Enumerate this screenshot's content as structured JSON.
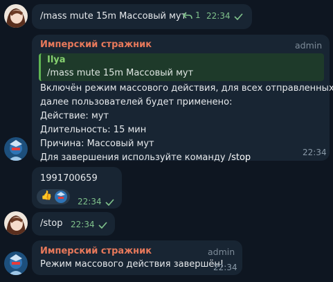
{
  "messages": {
    "m1": {
      "text": "/mass mute 15m Массовый мут",
      "replies": "1",
      "time": "22:34"
    },
    "m2": {
      "sender": "Имперский стражник",
      "role": "admin",
      "quote_author": "Ilya",
      "quote_text": "/mass mute 15m Массовый мут",
      "lines": [
        "Включён режим массового действия, для всех отправленных",
        "далее пользователей будет применено:",
        "Действие: мут",
        "Длительность: 15 мин",
        "Причина: Массовый мут"
      ],
      "last_prefix": "Для завершения используйте команду ",
      "last_cmd": "/stop",
      "time": "22:34"
    },
    "m3": {
      "text": "1991700659",
      "time": "22:34",
      "reaction": "👍"
    },
    "m4": {
      "text": "/stop",
      "time": "22:34"
    },
    "m5": {
      "sender": "Имперский стражник",
      "role": "admin",
      "text": "Режим массового действия завершён!",
      "time": "22:34"
    }
  },
  "colors": {
    "background": "#0e1621",
    "bubble": "#182533",
    "accent_green": "#86d16f",
    "sender_red": "#e8795b"
  }
}
